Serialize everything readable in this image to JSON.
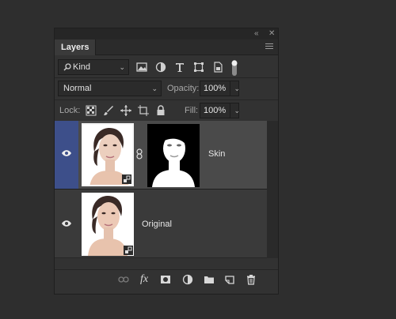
{
  "panel": {
    "title": "Layers",
    "collapse_glyph": "«",
    "close_glyph": "✕"
  },
  "filter": {
    "kind_label": "Kind",
    "icons": [
      "image-filter-icon",
      "adjustment-filter-icon",
      "type-filter-icon",
      "shape-filter-icon",
      "smart-object-filter-icon",
      "filter-toggle-icon"
    ]
  },
  "blend": {
    "mode": "Normal",
    "opacity_label": "Opacity:",
    "opacity_value": "100%"
  },
  "lock": {
    "label": "Lock:",
    "fill_label": "Fill:",
    "fill_value": "100%"
  },
  "layers": [
    {
      "name": "Skin",
      "visible": true,
      "selected": true,
      "has_mask": true
    },
    {
      "name": "Original",
      "visible": true,
      "selected": false,
      "has_mask": false
    }
  ],
  "colors": {
    "selected_layer": "#4a4a4a",
    "selected_eye": "#3d4f8a",
    "panel_bg": "#323232"
  },
  "bottom_bar": {
    "fx_label": "fx"
  }
}
